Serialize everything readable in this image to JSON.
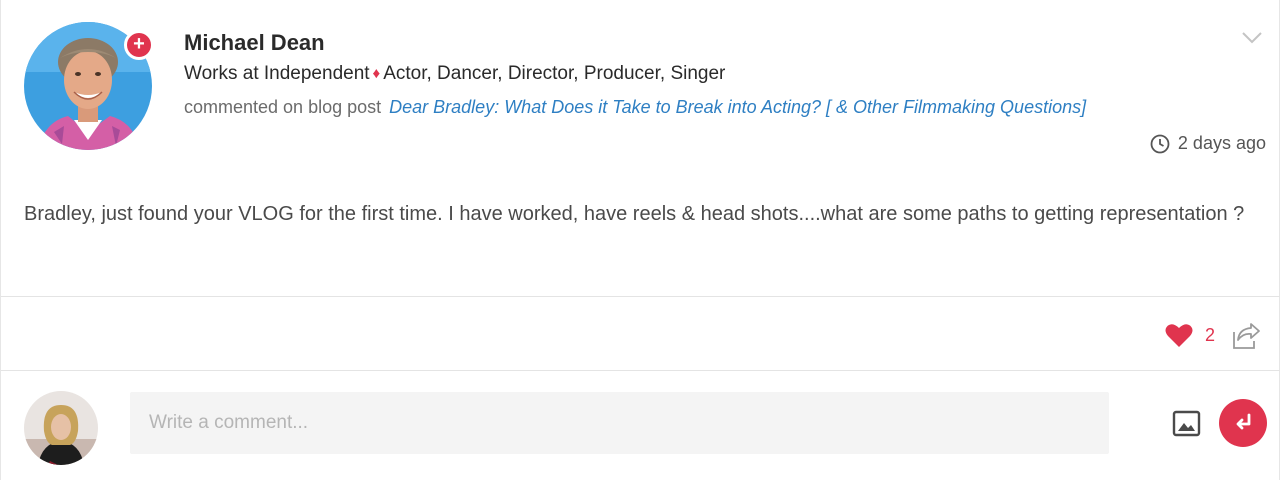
{
  "post": {
    "author": {
      "name": "Michael Dean",
      "workplace": "Works at Independent",
      "roles": "Actor, Dancer, Director, Producer, Singer",
      "follow_symbol": "+"
    },
    "activity": {
      "prefix": "commented on blog post",
      "link_text": "Dear Bradley: What Does it Take to Break into Acting? [ & Other Filmmaking Questions]"
    },
    "time": "2 days ago",
    "body": "Bradley, just found your VLOG for the first time. I have worked, have reels & head shots....what are some paths to getting representation ?",
    "likes": "2"
  },
  "reply": {
    "placeholder": "Write a comment..."
  },
  "colors": {
    "accent": "#e0344e",
    "link": "#2e7fc3"
  }
}
